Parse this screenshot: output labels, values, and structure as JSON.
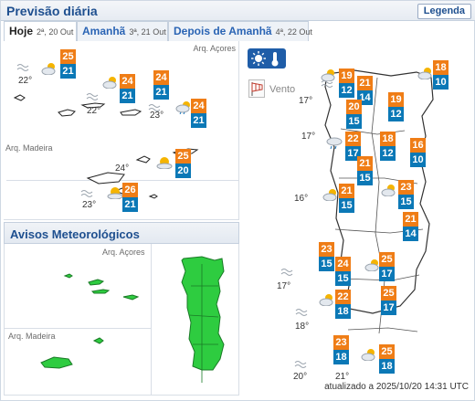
{
  "header": {
    "title": "Previsão diária",
    "legend_label": "Legenda"
  },
  "tabs": [
    {
      "name": "Hoje",
      "date": "2ª, 20 Out"
    },
    {
      "name": "Amanhã",
      "date": "3ª, 21 Out"
    },
    {
      "name": "Depois de Amanhã",
      "date": "4ª, 22 Out"
    }
  ],
  "islands": {
    "azores_label": "Arq. Açores",
    "madeira_label": "Arq. Madeira",
    "azores": [
      {
        "max": "25",
        "min": "21",
        "sea": "22°",
        "icon": "partly-cloudy-icon"
      },
      {
        "max": "24",
        "min": "21",
        "sea": "22°",
        "icon": "partly-cloudy-icon"
      },
      {
        "max": "24",
        "min": "21",
        "sea": "",
        "icon": ""
      },
      {
        "max": "24",
        "min": "21",
        "sea": "23°",
        "icon": "sun-cloud-rain-icon"
      }
    ],
    "madeira": [
      {
        "max": "25",
        "min": "20",
        "sea": "24°",
        "icon": "sun-cloud-icon"
      },
      {
        "max": "26",
        "min": "21",
        "sea": "23°",
        "icon": "sun-cloud-icon"
      }
    ]
  },
  "warnings": {
    "title": "Avisos Meteorológicos",
    "azores_label": "Arq. Açores",
    "madeira_label": "Arq. Madeira",
    "level_color": "#2ecc40"
  },
  "mainland": {
    "wind_label": "Vento",
    "sea": [
      "17°",
      "17°",
      "16°",
      "17°",
      "18°",
      "20°",
      "21°"
    ],
    "cities": [
      {
        "max": "19",
        "min": "12"
      },
      {
        "max": "21",
        "min": "14"
      },
      {
        "max": "18",
        "min": "10"
      },
      {
        "max": "20",
        "min": "15"
      },
      {
        "max": "19",
        "min": "12"
      },
      {
        "max": "22",
        "min": "17"
      },
      {
        "max": "18",
        "min": "12"
      },
      {
        "max": "21",
        "min": "15"
      },
      {
        "max": "16",
        "min": "10"
      },
      {
        "max": "21",
        "min": "15"
      },
      {
        "max": "23",
        "min": "15"
      },
      {
        "max": "21",
        "min": "14"
      },
      {
        "max": "23",
        "min": "15"
      },
      {
        "max": "24",
        "min": "15"
      },
      {
        "max": "25",
        "min": "17"
      },
      {
        "max": "22",
        "min": "18"
      },
      {
        "max": "25",
        "min": "17"
      },
      {
        "max": "23",
        "min": "18"
      },
      {
        "max": "25",
        "min": "18"
      }
    ],
    "updated": "atualizado a 2025/10/20 14:31 UTC"
  },
  "colors": {
    "max_tile": "#ef7d16",
    "min_tile": "#0b78b6",
    "warning_green": "#2ecc40",
    "accent": "#1e4f8f"
  }
}
